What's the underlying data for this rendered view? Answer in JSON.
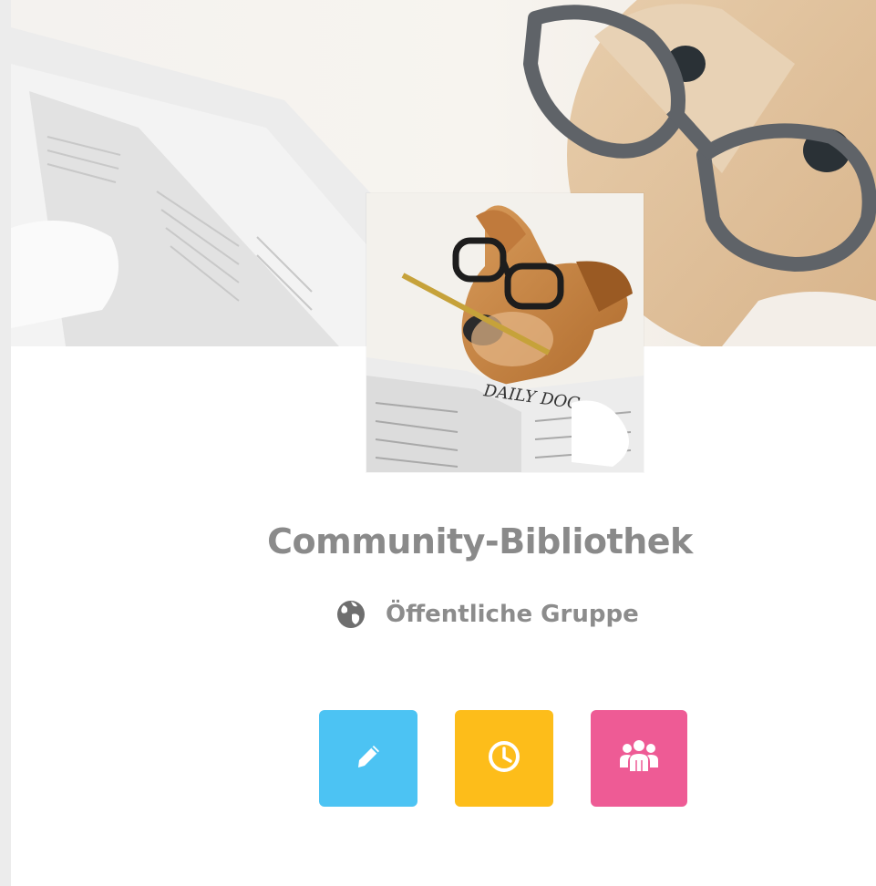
{
  "group": {
    "name": "Community-Bibliothek",
    "privacy_label": "Öffentliche Gruppe",
    "privacy_icon": "globe-icon"
  },
  "cover": {
    "description_icon": "dog-with-glasses-newspaper-photo",
    "newspaper_masthead": "DAILY DOG"
  },
  "actions": [
    {
      "id": "edit",
      "icon": "pencil-icon",
      "color": "#4cc3f3"
    },
    {
      "id": "events",
      "icon": "clock-icon",
      "color": "#fdbd1a"
    },
    {
      "id": "members",
      "icon": "users-icon",
      "color": "#ee5b95"
    }
  ],
  "colors": {
    "name_text": "#8a8a8a",
    "sub_text": "#8c8c8c",
    "sidebar_strip": "#ececec"
  }
}
